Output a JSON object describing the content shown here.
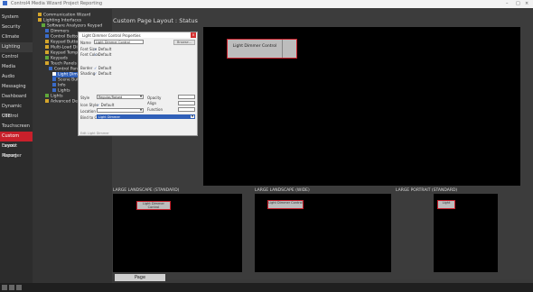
{
  "titlebar": {
    "text": "Control4 Media Wizard Project Reporting",
    "min": "–",
    "max": "□",
    "close": "×"
  },
  "sidebar": {
    "items": [
      "System",
      "Security",
      "Climate",
      "Lighting",
      "Control",
      "Media",
      "Audio",
      "Messaging",
      "Dashboard",
      "Dynamic Control",
      "UTE",
      "Touchscreen",
      "Custom Layout",
      "Event Manager",
      "Report"
    ]
  },
  "tree": {
    "items": [
      "Communication Wizard",
      "Lighting Interfaces",
      "Software Analyzers Keypad",
      "Dimmers",
      "Control Buttons",
      "Keypad Button Mapping",
      "Multi-Load Dimmers",
      "Keypad Templates",
      "Keypads",
      "Touch Panels",
      "Control Panels",
      "Light Dimmer Panel",
      "Scene Button",
      "Info",
      "Lights",
      "Lights",
      "Advanced Design"
    ]
  },
  "main": {
    "title": "Custom Page Layout : Status"
  },
  "canvas": {
    "button_label": "Light Dimmer Control"
  },
  "dialog": {
    "title": "Light Dimmer Control Properties",
    "name_label": "Name",
    "name_value": "Light Dimmer Control",
    "browse_label": "Browse...",
    "font_size_label": "Font Size",
    "font_size_check": "Default",
    "font_color_label": "Font Color",
    "font_color_check": "Default",
    "border_label": "Border",
    "border_check": "Default",
    "shading_label": "Shading",
    "shading_check": "Default",
    "style_label": "Style",
    "style_value": "Regular/Raised",
    "opacity_label": "Opacity",
    "icon_style_label": "Icon Style",
    "icon_style_check": "Default",
    "align_label": "Align",
    "function_label": "Function",
    "location_label": "Location",
    "bind_label": "Bind to Ctrl",
    "bind_value": "Light Dimmer",
    "note": "Edit Light Dimmer"
  },
  "panes": {
    "p1_title": "LARGE LANDSCAPE (STANDARD)",
    "p2_title": "LARGE LANDSCAPE (WIDE)",
    "p3_title": "LARGE PORTRAIT (STANDARD)",
    "p1_button": "Light Dimmer Control",
    "p2_button": "Light Dimmer Control",
    "p3_button": "Light"
  },
  "bottom": {
    "tab": "Page"
  },
  "colors": {
    "accent": "#c8202b",
    "highlight": "#2f5fb8",
    "canvas": "#000000"
  }
}
